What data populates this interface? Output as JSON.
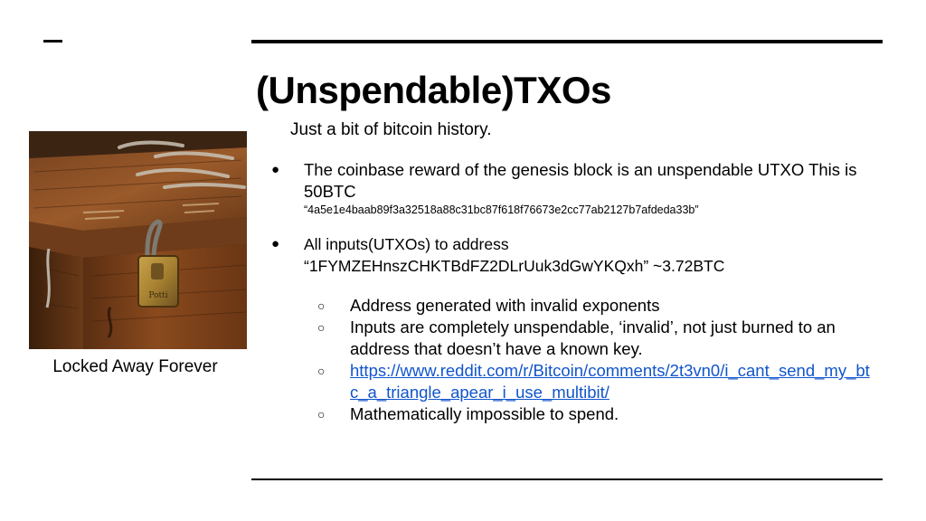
{
  "slide": {
    "title": "(Unspendable)TXOs",
    "subtitle": "Just a bit of bitcoin history.",
    "image_caption": "Locked Away Forever",
    "image_label": "Locked chest with padlock",
    "padlock_text": "Potti",
    "bullets": [
      {
        "text": "The coinbase reward of the genesis block is an unspendable UTXO This is 50BTC",
        "detail": "“4a5e1e4baab89f3a32518a88c31bc87f618f76673e2cc77ab2127b7afdeda33b”"
      },
      {
        "text": "All inputs(UTXOs) to address",
        "detail": "“1FYMZEHnszCHKTBdFZ2DLrUuk3dGwYKQxh” ~3.72BTC",
        "subitems": [
          "Address generated with invalid exponents",
          "Inputs are completely unspendable, ‘invalid’, not just burned to an address that doesn’t have a known key.",
          "https://www.reddit.com/r/Bitcoin/comments/2t3vn0/i_cant_send_my_btc_a_triangle_apear_i_use_multibit/",
          "Mathematically impossible to spend."
        ]
      }
    ],
    "bullet_symbol": "●",
    "subbullet_symbol": "○",
    "link_color": "#1155cc"
  }
}
